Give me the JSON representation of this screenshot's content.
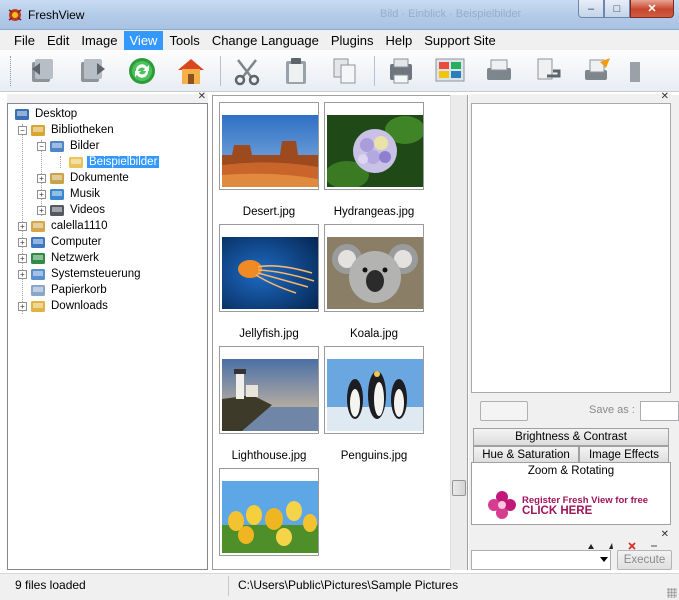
{
  "window": {
    "title": "FreshView",
    "ghost_title": "Bild · Einblick · Beispielbilder",
    "controls": {
      "minimize": "–",
      "maximize": "□",
      "close": "✕"
    }
  },
  "menu": [
    "File",
    "Edit",
    "Image",
    "View",
    "Tools",
    "Change Language",
    "Plugins",
    "Help",
    "Support Site"
  ],
  "menu_active": "View",
  "toolbar": {
    "buttons": [
      "back-icon",
      "forward-icon",
      "refresh-icon",
      "home-icon",
      "cut-icon",
      "paste-icon",
      "copy-icon",
      "print-preview-icon",
      "slideshow-icon",
      "scan-icon",
      "convert-icon",
      "send-icon",
      "more-icon"
    ]
  },
  "tree": {
    "items": [
      {
        "label": "Desktop",
        "icon": "desktop-icon",
        "level": 0,
        "expander": ""
      },
      {
        "label": "Bibliotheken",
        "icon": "library-icon",
        "level": 1,
        "expander": "−"
      },
      {
        "label": "Bilder",
        "icon": "pictures-icon",
        "level": 2,
        "expander": "−"
      },
      {
        "label": "Beispielbilder",
        "icon": "folder-icon",
        "level": 3,
        "expander": "",
        "selected": true
      },
      {
        "label": "Dokumente",
        "icon": "documents-icon",
        "level": 2,
        "expander": "+"
      },
      {
        "label": "Musik",
        "icon": "music-icon",
        "level": 2,
        "expander": "+"
      },
      {
        "label": "Videos",
        "icon": "videos-icon",
        "level": 2,
        "expander": "+"
      },
      {
        "label": "calella1110",
        "icon": "user-icon",
        "level": 1,
        "expander": "+"
      },
      {
        "label": "Computer",
        "icon": "computer-icon",
        "level": 1,
        "expander": "+"
      },
      {
        "label": "Netzwerk",
        "icon": "network-icon",
        "level": 1,
        "expander": "+"
      },
      {
        "label": "Systemsteuerung",
        "icon": "control-panel-icon",
        "level": 1,
        "expander": "+"
      },
      {
        "label": "Papierkorb",
        "icon": "recycle-bin-icon",
        "level": 1,
        "expander": ""
      },
      {
        "label": "Downloads",
        "icon": "downloads-icon",
        "level": 1,
        "expander": "+"
      }
    ]
  },
  "thumbnails": [
    {
      "name": "Desert.jpg"
    },
    {
      "name": "Hydrangeas.jpg"
    },
    {
      "name": "Jellyfish.jpg"
    },
    {
      "name": "Koala.jpg"
    },
    {
      "name": "Lighthouse.jpg"
    },
    {
      "name": "Penguins.jpg"
    },
    {
      "name": ""
    }
  ],
  "right_panel": {
    "save_as_label": "Save as :",
    "tabs": [
      "Brightness & Contrast",
      "Hue & Saturation",
      "Image Effects",
      "Zoom & Rotating"
    ],
    "active_tab": "Zoom & Rotating",
    "banner_line1": "Register Fresh View for free",
    "banner_line2": "CLICK HERE",
    "execute_label": "Execute"
  },
  "status": {
    "files_loaded": "9 files loaded",
    "path": "C:\\Users\\Public\\Pictures\\Sample Pictures"
  },
  "colors": {
    "selection": "#3399ff",
    "banner_text": "#a0135a",
    "titlebar": "#b9cfeb"
  }
}
